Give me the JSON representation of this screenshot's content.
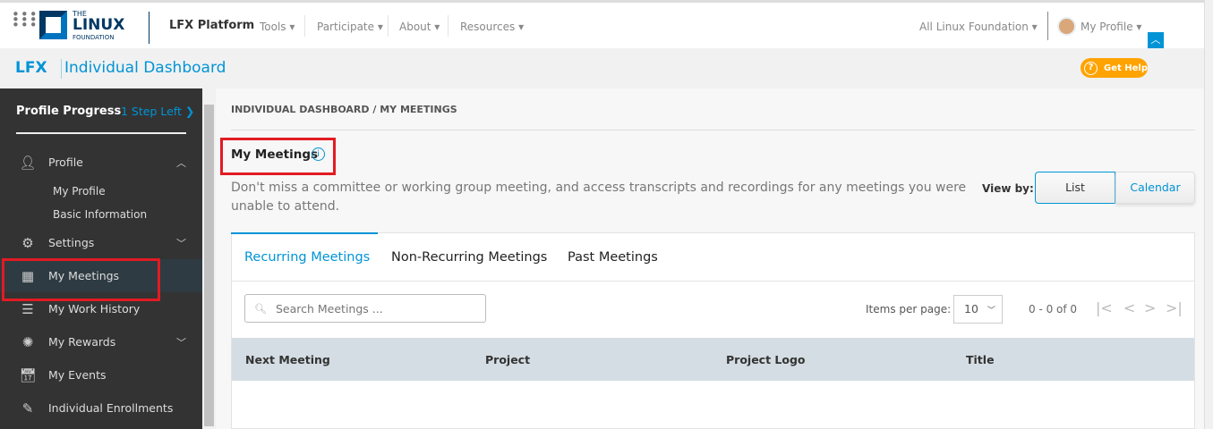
{
  "topnav": {
    "logo_the": "THE",
    "logo_linux": "LINUX",
    "logo_foundation": "FOUNDATION",
    "platform": "LFX Platform",
    "menus": [
      "Tools",
      "Participate",
      "About",
      "Resources"
    ],
    "org_select": "All Linux Foundation",
    "profile": "My Profile"
  },
  "subheader": {
    "lfx": "LFX",
    "title": "Individual Dashboard",
    "help": "Get Help"
  },
  "sidebar": {
    "progress_label": "Profile Progress",
    "progress_link": "1 Step Left",
    "items": [
      {
        "label": "Profile",
        "icon": "user-icon"
      },
      {
        "label": "Settings",
        "icon": "gear-icon"
      },
      {
        "label": "My Meetings",
        "icon": "calendar-grid-icon"
      },
      {
        "label": "My Work History",
        "icon": "list-icon"
      },
      {
        "label": "My Rewards",
        "icon": "badge-icon"
      },
      {
        "label": "My Events",
        "icon": "event-icon"
      },
      {
        "label": "Individual Enrollments",
        "icon": "form-edit-icon"
      }
    ],
    "profile_sub": [
      "My Profile",
      "Basic Information"
    ]
  },
  "main": {
    "breadcrumb": "INDIVIDUAL DASHBOARD / MY MEETINGS",
    "title": "My Meetings",
    "description": "Don't miss a committee or working group meeting, and access transcripts and recordings for any meetings you were unable to attend.",
    "view_by": "View by:",
    "view_list": "List",
    "view_calendar": "Calendar",
    "tabs": [
      "Recurring Meetings",
      "Non-Recurring Meetings",
      "Past Meetings"
    ],
    "search_placeholder": "Search Meetings ...",
    "items_per_page_label": "Items per page:",
    "items_per_page": "10",
    "range": "0 - 0 of 0",
    "columns": [
      "Next Meeting",
      "Project",
      "Project Logo",
      "Title"
    ]
  },
  "colors": {
    "accent": "#0094d6",
    "sidebar": "#333333",
    "help": "#ffa300",
    "highlight": "#e21b23"
  }
}
